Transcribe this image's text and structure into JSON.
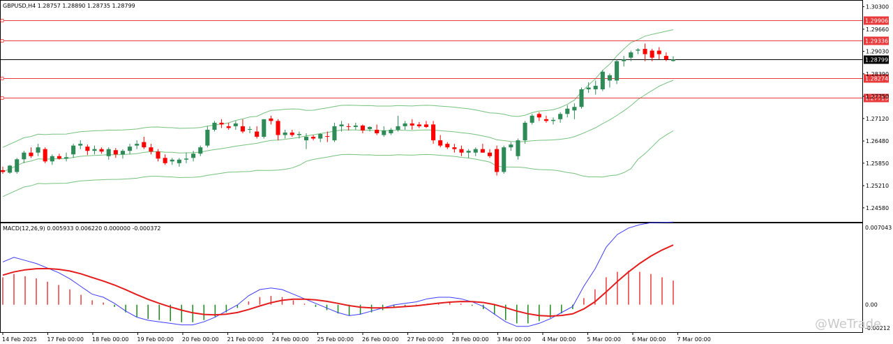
{
  "main_header": "GBPUSD,H4  1.28757 1.28890 1.28735 1.28799",
  "macd_header": "MACD(12,26,9) 0.005933 0.006220 0.000000 -0.000372",
  "watermark": "@WeTrade",
  "chart_data": [
    {
      "type": "candlestick",
      "ylim": [
        1.242,
        1.3045
      ],
      "price_ticks": [
        "1.30300",
        "1.29660",
        "1.29030",
        "1.28390",
        "1.27750",
        "1.27120",
        "1.26480",
        "1.25850",
        "1.25210",
        "1.24580"
      ],
      "x_labels": [
        "14 Feb 2025",
        "17 Feb 00:00",
        "18 Feb 00:00",
        "19 Feb 00:00",
        "20 Feb 00:00",
        "21 Feb 00:00",
        "24 Feb 00:00",
        "25 Feb 00:00",
        "26 Feb 00:00",
        "27 Feb 00:00",
        "28 Feb 00:00",
        "3 Mar 00:00",
        "4 Mar 00:00",
        "5 Mar 00:00",
        "6 Mar 00:00",
        "7 Mar 00:00"
      ],
      "horizontal_lines": [
        {
          "label": "1.29906",
          "value": 1.29906,
          "color": "#e83a3a"
        },
        {
          "label": "1.29336",
          "value": 1.29336,
          "color": "#e83a3a"
        },
        {
          "label": "1.28799",
          "value": 1.28799,
          "color": "#000000"
        },
        {
          "label": "1.28274",
          "value": 1.28274,
          "color": "#e83a3a"
        },
        {
          "label": "1.27713",
          "value": 1.27713,
          "color": "#e83a3a"
        }
      ],
      "candles_ohlc": [
        [
          1.2565,
          1.2575,
          1.2555,
          1.256
        ],
        [
          1.2558,
          1.258,
          1.2555,
          1.2578
        ],
        [
          1.256,
          1.26,
          1.2555,
          1.2596
        ],
        [
          1.2596,
          1.262,
          1.2585,
          1.2615
        ],
        [
          1.2615,
          1.263,
          1.26,
          1.2605
        ],
        [
          1.2615,
          1.264,
          1.2605,
          1.263
        ],
        [
          1.2625,
          1.263,
          1.2585,
          1.259
        ],
        [
          1.259,
          1.261,
          1.258,
          1.2605
        ],
        [
          1.2605,
          1.2612,
          1.2595,
          1.2598
        ],
        [
          1.2598,
          1.2615,
          1.259,
          1.2602
        ],
        [
          1.261,
          1.264,
          1.26,
          1.2635
        ],
        [
          1.2635,
          1.265,
          1.2625,
          1.264
        ],
        [
          1.2632,
          1.2638,
          1.2608,
          1.262
        ],
        [
          1.262,
          1.2635,
          1.261,
          1.2625
        ],
        [
          1.2625,
          1.263,
          1.2612,
          1.2618
        ],
        [
          1.2605,
          1.263,
          1.2595,
          1.2625
        ],
        [
          1.2622,
          1.2628,
          1.26,
          1.261
        ],
        [
          1.261,
          1.2625,
          1.2598,
          1.262
        ],
        [
          1.262,
          1.264,
          1.261,
          1.2632
        ],
        [
          1.2635,
          1.265,
          1.2625,
          1.264
        ],
        [
          1.2645,
          1.266,
          1.2625,
          1.263
        ],
        [
          1.263,
          1.264,
          1.261,
          1.2618
        ],
        [
          1.2618,
          1.2625,
          1.259,
          1.2598
        ],
        [
          1.26,
          1.261,
          1.258,
          1.2585
        ],
        [
          1.259,
          1.26,
          1.258,
          1.2595
        ],
        [
          1.2585,
          1.26,
          1.2575,
          1.2595
        ],
        [
          1.2595,
          1.2615,
          1.2585,
          1.2598
        ],
        [
          1.26,
          1.262,
          1.259,
          1.2612
        ],
        [
          1.2612,
          1.2635,
          1.2605,
          1.263
        ],
        [
          1.2635,
          1.269,
          1.263,
          1.268
        ],
        [
          1.268,
          1.2705,
          1.2675,
          1.27
        ],
        [
          1.27,
          1.271,
          1.2685,
          1.2695
        ],
        [
          1.269,
          1.27,
          1.268,
          1.2685
        ],
        [
          1.269,
          1.2705,
          1.268,
          1.2698
        ],
        [
          1.269,
          1.271,
          1.267,
          1.2675
        ],
        [
          1.268,
          1.269,
          1.267,
          1.2682
        ],
        [
          1.2675,
          1.269,
          1.2655,
          1.266
        ],
        [
          1.266,
          1.271,
          1.2655,
          1.271
        ],
        [
          1.2712,
          1.272,
          1.2695,
          1.2705
        ],
        [
          1.2705,
          1.271,
          1.265,
          1.2665
        ],
        [
          1.2665,
          1.268,
          1.2655,
          1.2672
        ],
        [
          1.2672,
          1.268,
          1.266,
          1.2665
        ],
        [
          1.2665,
          1.2675,
          1.2655,
          1.2668
        ],
        [
          1.265,
          1.267,
          1.2625,
          1.266
        ],
        [
          1.266,
          1.2665,
          1.265,
          1.2655
        ],
        [
          1.2655,
          1.267,
          1.2645,
          1.2668
        ],
        [
          1.2662,
          1.2675,
          1.2645,
          1.266
        ],
        [
          1.265,
          1.27,
          1.2645,
          1.269
        ],
        [
          1.269,
          1.2705,
          1.2675,
          1.2695
        ],
        [
          1.269,
          1.2698,
          1.2678,
          1.2688
        ],
        [
          1.2688,
          1.27,
          1.268,
          1.2692
        ],
        [
          1.2692,
          1.2695,
          1.267,
          1.2678
        ],
        [
          1.2682,
          1.269,
          1.2675,
          1.2688
        ],
        [
          1.268,
          1.2695,
          1.2665,
          1.267
        ],
        [
          1.2665,
          1.269,
          1.266,
          1.2678
        ],
        [
          1.267,
          1.2685,
          1.2665,
          1.268
        ],
        [
          1.268,
          1.272,
          1.2675,
          1.269
        ],
        [
          1.269,
          1.2705,
          1.268,
          1.2698
        ],
        [
          1.2698,
          1.271,
          1.268,
          1.2692
        ],
        [
          1.2695,
          1.2702,
          1.2685,
          1.269
        ],
        [
          1.2695,
          1.2705,
          1.2685,
          1.2688
        ],
        [
          1.2695,
          1.2705,
          1.264,
          1.265
        ],
        [
          1.265,
          1.2665,
          1.263,
          1.2635
        ],
        [
          1.264,
          1.2645,
          1.2625,
          1.263
        ],
        [
          1.263,
          1.264,
          1.2615,
          1.2625
        ],
        [
          1.2625,
          1.2635,
          1.2605,
          1.2615
        ],
        [
          1.2615,
          1.2625,
          1.26,
          1.262
        ],
        [
          1.2615,
          1.263,
          1.2605,
          1.2625
        ],
        [
          1.2625,
          1.264,
          1.2615,
          1.2615
        ],
        [
          1.2615,
          1.2625,
          1.26,
          1.2605
        ],
        [
          1.2625,
          1.2635,
          1.255,
          1.256
        ],
        [
          1.256,
          1.2635,
          1.2555,
          1.263
        ],
        [
          1.263,
          1.2645,
          1.262,
          1.2638
        ],
        [
          1.2605,
          1.2655,
          1.2595,
          1.265
        ],
        [
          1.265,
          1.2705,
          1.264,
          1.27
        ],
        [
          1.27,
          1.2725,
          1.2695,
          1.272
        ],
        [
          1.2725,
          1.273,
          1.2705,
          1.2715
        ],
        [
          1.271,
          1.272,
          1.27,
          1.2705
        ],
        [
          1.2705,
          1.2715,
          1.2695,
          1.2708
        ],
        [
          1.271,
          1.273,
          1.27,
          1.2725
        ],
        [
          1.2725,
          1.275,
          1.2715,
          1.274
        ],
        [
          1.2735,
          1.2755,
          1.271,
          1.2745
        ],
        [
          1.2745,
          1.28,
          1.274,
          1.2795
        ],
        [
          1.2795,
          1.2815,
          1.2785,
          1.28
        ],
        [
          1.2795,
          1.282,
          1.278,
          1.2805
        ],
        [
          1.2795,
          1.285,
          1.279,
          1.2845
        ],
        [
          1.282,
          1.284,
          1.28,
          1.2835
        ],
        [
          1.282,
          1.288,
          1.281,
          1.2875
        ],
        [
          1.2875,
          1.289,
          1.286,
          1.288
        ],
        [
          1.2885,
          1.2905,
          1.2875,
          1.29
        ],
        [
          1.2905,
          1.2912,
          1.2895,
          1.2908
        ],
        [
          1.291,
          1.2925,
          1.2875,
          1.2895
        ],
        [
          1.2905,
          1.291,
          1.2875,
          1.2885
        ],
        [
          1.2905,
          1.2915,
          1.288,
          1.2895
        ],
        [
          1.289,
          1.29,
          1.2875,
          1.288
        ],
        [
          1.28757,
          1.2889,
          1.28735,
          1.28799
        ]
      ]
    },
    {
      "type": "bar",
      "title": "MACD(12,26,9)",
      "ylim": [
        -0.00212,
        0.007043
      ],
      "tick_labels": [
        "0.007043",
        "0.00",
        "-0.00212"
      ],
      "histogram_count": 61,
      "histogram_values": [
        0.0025,
        0.0028,
        0.0026,
        0.0024,
        0.0021,
        0.0018,
        0.0014,
        0.0009,
        0.0004,
        0.0002,
        -0.0002,
        -0.0007,
        -0.0011,
        -0.0013,
        -0.0014,
        -0.0015,
        -0.0016,
        -0.0016,
        -0.0014,
        -0.0011,
        -0.0007,
        -0.0003,
        0.0003,
        0.0007,
        0.0008,
        0.0007,
        0.0004,
        0.0001,
        -0.0002,
        -0.0005,
        -0.0008,
        -0.001,
        -0.0009,
        -0.0007,
        -0.0005,
        -0.0003,
        -0.0002,
        -0.0001,
        0.0001,
        0.0002,
        0.0002,
        0.0001,
        -0.0001,
        -0.0004,
        -0.0009,
        -0.0014,
        -0.0017,
        -0.0017,
        -0.0015,
        -0.0012,
        -0.0008,
        -0.0004,
        0.0006,
        0.0014,
        0.0025,
        0.003,
        0.0031,
        0.003,
        0.0028,
        0.0025,
        0.0022
      ],
      "colors": {
        "histogram_up": "#e83a3a",
        "histogram_down": "#1a8a1a",
        "macd_line": "#3c3cff",
        "signal_line": "#e51c1c"
      }
    }
  ],
  "colors": {
    "bull": "#2e8b57",
    "bear": "#ff0000",
    "band": "#76c27e",
    "grid_border": "#000000"
  }
}
